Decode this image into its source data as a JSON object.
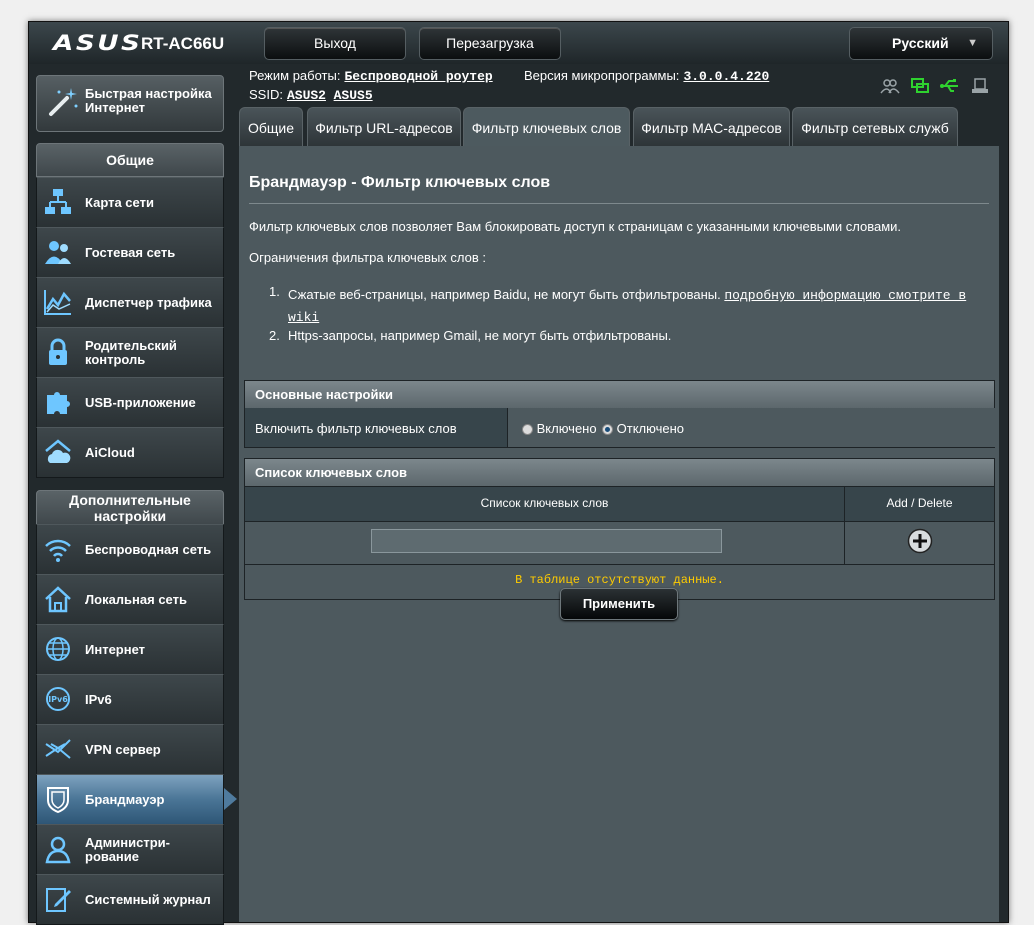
{
  "header": {
    "brand": "ASUS",
    "model": "RT-AC66U",
    "logout_label": "Выход",
    "reboot_label": "Перезагрузка",
    "language": "Русский"
  },
  "status": {
    "mode_label": "Режим работы:",
    "mode_value": "Беспроводной роутер",
    "firmware_label": "Версия микропрограммы:",
    "firmware_value": "3.0.0.4.220",
    "ssid_label": "SSID:",
    "ssid_1": "ASUS2",
    "ssid_2": "ASUS5"
  },
  "sidebar": {
    "quick_setup": "Быстрая настройка Интернет",
    "general_header": "Общие",
    "general_items": [
      {
        "label": "Карта сети"
      },
      {
        "label": "Гостевая сеть"
      },
      {
        "label": "Диспетчер трафика"
      },
      {
        "label": "Родительский контроль"
      },
      {
        "label": "USB-приложение"
      },
      {
        "label": "AiCloud"
      }
    ],
    "advanced_header": "Дополнительные настройки",
    "advanced_items": [
      {
        "label": "Беспроводная сеть"
      },
      {
        "label": "Локальная сеть"
      },
      {
        "label": "Интернет"
      },
      {
        "label": "IPv6"
      },
      {
        "label": "VPN сервер"
      },
      {
        "label": "Брандмауэр"
      },
      {
        "label": "Администри-рование"
      },
      {
        "label": "Системный журнал"
      }
    ]
  },
  "tabs": [
    {
      "label": "Общие"
    },
    {
      "label": "Фильтр URL-адресов"
    },
    {
      "label": "Фильтр ключевых слов"
    },
    {
      "label": "Фильтр MAC-адресов"
    },
    {
      "label": "Фильтр сетевых служб"
    }
  ],
  "main": {
    "title": "Брандмауэр - Фильтр ключевых слов",
    "description": "Фильтр ключевых слов позволяет Вам блокировать доступ к страницам с указанными ключевыми словами.",
    "limits_heading": "Ограничения фильтра ключевых слов :",
    "limit_1_num": "1.",
    "limit_1_text": "Сжатые веб-страницы, например Baidu, не могут быть отфильтрованы.",
    "limit_1_link_a": "подробную информацию смотрите в",
    "limit_1_link_b": "wiki",
    "limit_2_num": "2.",
    "limit_2_text": "Https-запросы, например Gmail, не могут быть отфильтрованы.",
    "basic_settings_header": "Основные настройки",
    "enable_label": "Включить фильтр ключевых слов",
    "radio_on": "Включено",
    "radio_off": "Отключено",
    "list_header": "Список ключевых слов",
    "col_keyword": "Список ключевых слов",
    "col_action": "Add / Delete",
    "keyword_input_value": "",
    "empty_text": "В таблице отсутствуют данные.",
    "apply_label": "Применить"
  }
}
